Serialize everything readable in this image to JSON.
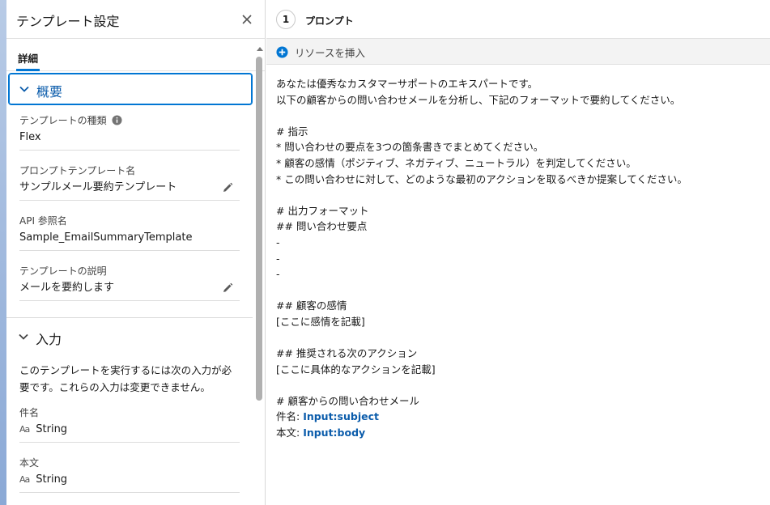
{
  "panel": {
    "title": "テンプレート設定",
    "tab_detail": "詳細"
  },
  "overview": {
    "title": "概要",
    "template_type_label": "テンプレートの種類",
    "template_type_value": "Flex",
    "name_label": "プロンプトテンプレート名",
    "name_value": "サンプルメール要約テンプレート",
    "api_label": "API 参照名",
    "api_value": "Sample_EmailSummaryTemplate",
    "description_label": "テンプレートの説明",
    "description_value": "メールを要約します"
  },
  "inputs": {
    "title": "入力",
    "description_line1": "このテンプレートを実行するには次の入力が必",
    "description_line2": "要です。これらの入力は変更できません。",
    "items": [
      {
        "label": "件名",
        "type_icon": "Aa",
        "type": "String"
      },
      {
        "label": "本文",
        "type_icon": "Aa",
        "type": "String"
      }
    ]
  },
  "step": {
    "number": "1",
    "label": "プロンプト"
  },
  "toolbar": {
    "insert_label": "リソースを挿入"
  },
  "prompt_lines": [
    "あなたは優秀なカスタマーサポートのエキスパートです。",
    "以下の顧客からの問い合わせメールを分析し、下記のフォーマットで要約してください。",
    "",
    "# 指示",
    "* 問い合わせの要点を3つの箇条書きでまとめてください。",
    "* 顧客の感情（ポジティブ、ネガティブ、ニュートラル）を判定してください。",
    "* この問い合わせに対して、どのような最初のアクションを取るべきか提案してください。",
    "",
    "# 出力フォーマット",
    "## 問い合わせ要点",
    "-",
    "-",
    "-",
    "",
    "## 顧客の感情",
    "[ここに感情を記載]",
    "",
    "## 推奨される次のアクション",
    "[ここに具体的なアクションを記載]",
    "",
    "# 顧客からの問い合わせメール"
  ],
  "merge_fields": {
    "subject_prefix": "件名: ",
    "subject_token": "Input:subject",
    "body_prefix": "本文: ",
    "body_token": "Input:body"
  },
  "colors": {
    "accent": "#0176d3",
    "token": "#0b5cab"
  }
}
